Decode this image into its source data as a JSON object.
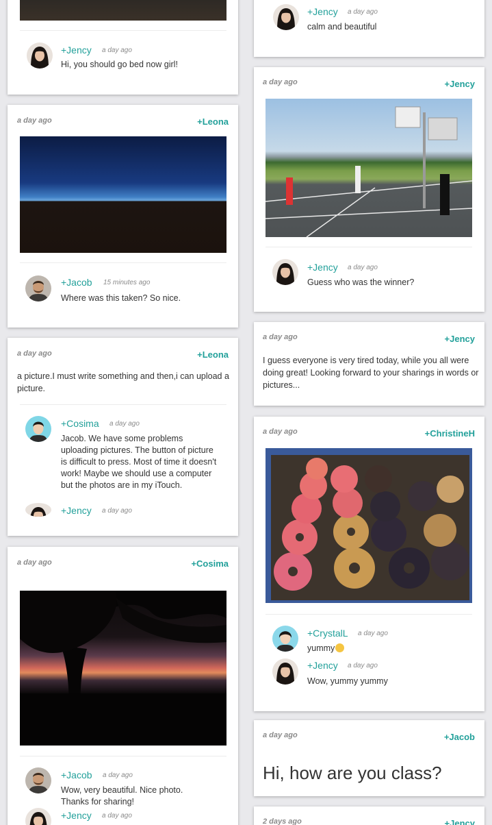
{
  "left": {
    "top_card": {
      "comment": {
        "name": "+Jency",
        "time": "a day ago",
        "text": "Hi, you should go bed now girl!"
      }
    },
    "post_leona_1": {
      "time": "a day ago",
      "author": "+Leona",
      "comment": {
        "name": "+Jacob",
        "time": "15 minutes ago",
        "text": "Where was this taken? So nice."
      }
    },
    "post_leona_2": {
      "time": "a day ago",
      "author": "+Leona",
      "text": "a picture.I must write something and then,i can upload a picture.",
      "comments": [
        {
          "name": "+Cosima",
          "time": "a day ago",
          "text": "Jacob. We have some problems uploading pictures. The button of picture is difficult to press. Most of time it doesn't work! Maybe we should use a computer but the photos are in my iTouch."
        },
        {
          "name": "+Jency",
          "time": "a day ago"
        }
      ]
    },
    "post_cosima": {
      "time": "a day ago",
      "author": "+Cosima",
      "comments": [
        {
          "name": "+Jacob",
          "time": "a day ago",
          "text": "Wow, very beautiful. Nice photo. Thanks for sharing!"
        },
        {
          "name": "+Jency",
          "time": "a day ago"
        }
      ]
    }
  },
  "right": {
    "top_card": {
      "comment": {
        "name": "+Jency",
        "time": "a day ago",
        "text": "calm and beautiful"
      }
    },
    "post_jency_court": {
      "time": "a day ago",
      "author": "+Jency",
      "comment": {
        "name": "+Jency",
        "time": "a day ago",
        "text": "Guess who was the winner?"
      }
    },
    "post_jency_text": {
      "time": "a day ago",
      "author": "+Jency",
      "text": "I guess everyone is very tired today, while you all were doing great! Looking forward to your sharings in words or pictures..."
    },
    "post_christine": {
      "time": "a day ago",
      "author": "+ChristineH",
      "comments": [
        {
          "name": "+CrystalL",
          "time": "a day ago",
          "text": "yummy"
        },
        {
          "name": "+Jency",
          "time": "a day ago",
          "text": "Wow, yummy yummy"
        }
      ]
    },
    "post_jacob": {
      "time": "a day ago",
      "author": "+Jacob",
      "text": "Hi, how are you class?"
    },
    "post_bottom": {
      "time": "2 days ago",
      "author": "+Jency"
    }
  },
  "icons": {
    "avatar_jency": "avatar-jency-icon",
    "avatar_jacob": "avatar-jacob-icon",
    "avatar_cosima": "avatar-cosima-icon",
    "avatar_crystal": "avatar-crystal-icon",
    "emoji": "smile-emoji-icon"
  },
  "colors": {
    "accent": "#22a09a",
    "meta": "#8a8a8a",
    "background": "#e9e9ec"
  }
}
